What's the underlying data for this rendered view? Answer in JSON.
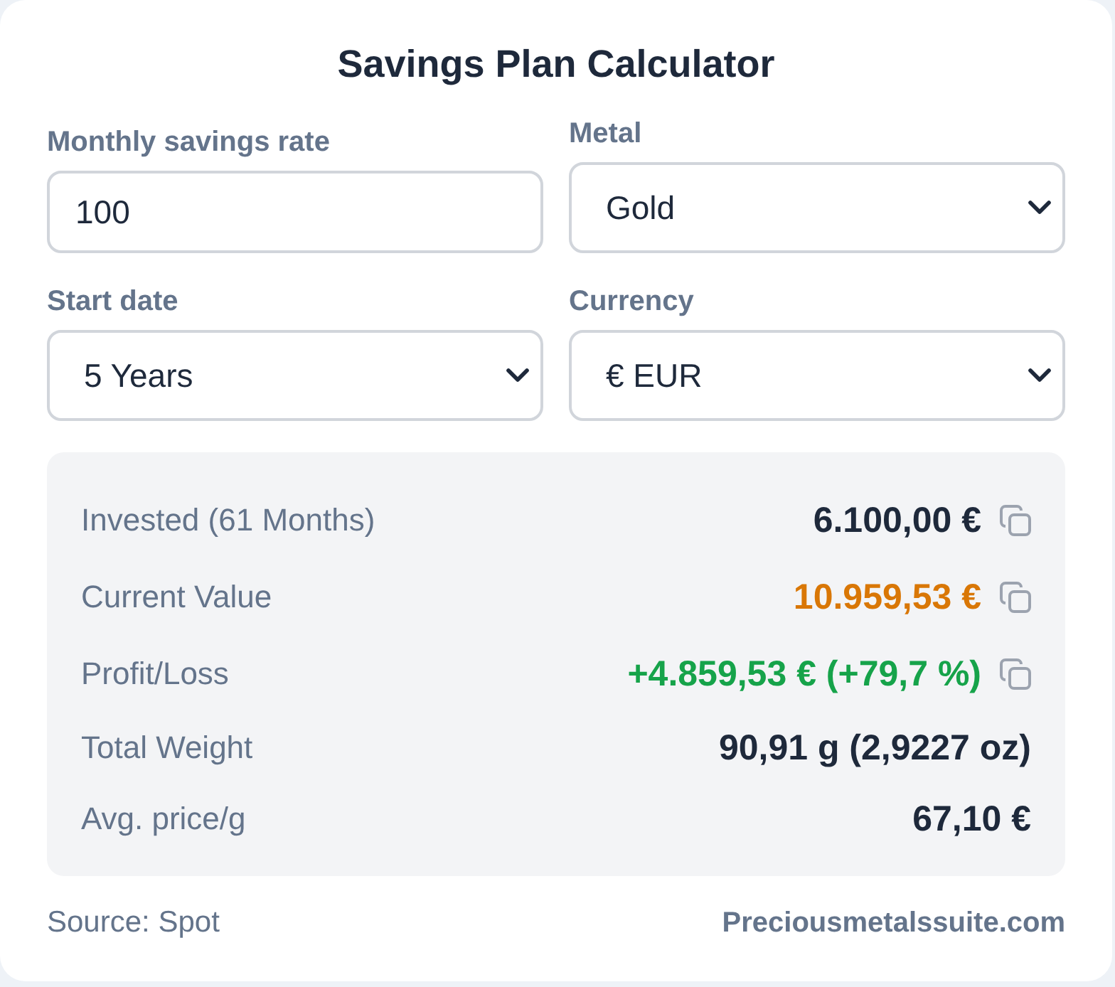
{
  "title": "Savings Plan Calculator",
  "fields": [
    {
      "label": "Monthly savings rate",
      "kind": "input",
      "value": "100"
    },
    {
      "label": "Metal",
      "kind": "select",
      "value": "Gold"
    },
    {
      "label": "Start date",
      "kind": "select",
      "value": "5 Years"
    },
    {
      "label": "Currency",
      "kind": "select",
      "value": "€ EUR"
    }
  ],
  "results": [
    {
      "label": "Invested (61 Months)",
      "value": "6.100,00 €",
      "color": "#1e293b",
      "copyable": true
    },
    {
      "label": "Current Value",
      "value": "10.959,53 €",
      "color": "#d97706",
      "copyable": true
    },
    {
      "label": "Profit/Loss",
      "value": "+4.859,53 € (+79,7 %)",
      "color": "#16a34a",
      "copyable": true
    },
    {
      "label": "Total Weight",
      "value": "90,91 g (2,9227 oz)",
      "color": "#1e293b",
      "copyable": false
    },
    {
      "label": "Avg. price/g",
      "value": "67,10 €",
      "color": "#1e293b",
      "copyable": false
    }
  ],
  "footer": {
    "source": "Source: Spot",
    "brand": "Preciousmetalssuite.com"
  }
}
